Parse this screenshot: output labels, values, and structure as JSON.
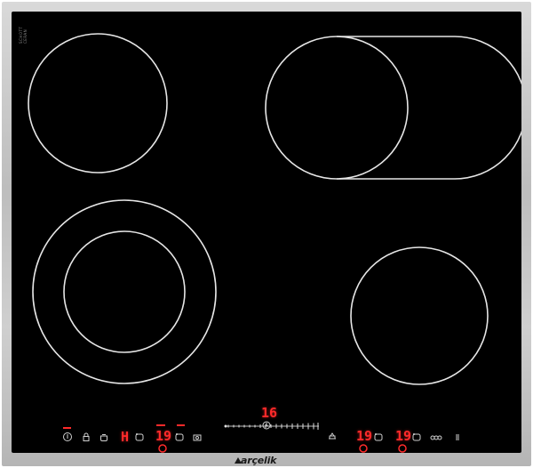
{
  "glass_marking": [
    "SCHOTT",
    "CERAN"
  ],
  "brand": "arçelik",
  "timer_display": "16",
  "controls": {
    "left_level": "H",
    "zone_front_left_level": "19",
    "zone_rear_right_level": "19",
    "zone_front_right_level": "19"
  },
  "colors": {
    "glass": "#000000",
    "ring": "#e6e6e6",
    "led": "#ff2a2a",
    "frame": "#c8c8c8"
  },
  "icons": [
    "power-icon",
    "lock-icon",
    "pot-icon",
    "zone-select-icon",
    "keep-warm-icon",
    "timer-icon",
    "cookware-icon",
    "bridge-icon",
    "dual-zone-icon"
  ]
}
